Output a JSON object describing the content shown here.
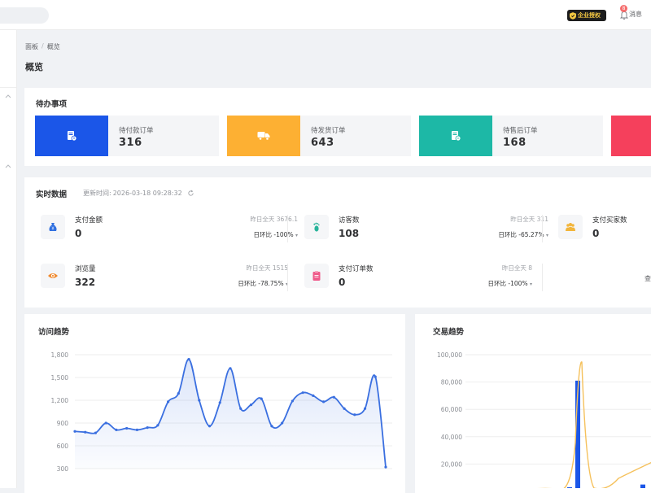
{
  "header": {
    "brand_badge": "企业授权",
    "messages_label": "消息",
    "messages_count": "8"
  },
  "breadcrumb": [
    "面板",
    "/",
    "概览"
  ],
  "page_title": "概览",
  "todo": {
    "title": "待办事项",
    "items": [
      {
        "label": "待付款订单",
        "value": "316",
        "color": "#1b56e8",
        "icon": "order-pay-icon"
      },
      {
        "label": "待发货订单",
        "value": "643",
        "color": "#fdb033",
        "icon": "truck-icon"
      },
      {
        "label": "待售后订单",
        "value": "168",
        "color": "#1db8a6",
        "icon": "after-sale-icon"
      },
      {
        "label": "",
        "value": "",
        "color": "#f5405c",
        "icon": "order-icon"
      }
    ]
  },
  "realtime": {
    "title": "实时数据",
    "update_label": "更新时间:",
    "update_time": "2026-03-18 09:28:32",
    "metrics": [
      {
        "label": "支付金额",
        "value": "0",
        "yesterday": "昨日全天 3676.1",
        "compare": "日环比 -100%",
        "icon": "money-bag-icon",
        "icon_color": "#2f6fe0"
      },
      {
        "label": "访客数",
        "value": "108",
        "yesterday": "昨日全天 311",
        "compare": "日环比 -65.27%",
        "icon": "footprint-icon",
        "icon_color": "#27b39a"
      },
      {
        "label": "支付买家数",
        "value": "0",
        "yesterday": "",
        "compare": "",
        "icon": "users-icon",
        "icon_color": "#f2b53a"
      },
      {
        "label": "浏览量",
        "value": "322",
        "yesterday": "昨日全天 1515",
        "compare": "日环比 -78.75%",
        "icon": "eye-icon",
        "icon_color": "#f08a2e"
      },
      {
        "label": "支付订单数",
        "value": "0",
        "yesterday": "昨日全天 8",
        "compare": "日环比 -100%",
        "icon": "clipboard-icon",
        "icon_color": "#ef5a8a"
      }
    ],
    "truncated_text": "查"
  },
  "visit_chart": {
    "title": "访问趋势",
    "y_ticks": [
      "1,800",
      "1,500",
      "1,200",
      "900",
      "600",
      "300"
    ]
  },
  "trade_chart": {
    "title": "交易趋势",
    "y_ticks": [
      "100,000",
      "80,000",
      "60,000",
      "40,000",
      "20,000"
    ]
  },
  "chart_data": [
    {
      "type": "line",
      "title": "访问趋势",
      "ylim": [
        300,
        1800
      ],
      "series": [
        {
          "values": [
            790,
            780,
            770,
            900,
            810,
            830,
            810,
            840,
            870,
            1180,
            1290,
            1740,
            1200,
            860,
            1170,
            1620,
            1090,
            1140,
            1220,
            860,
            900,
            1190,
            1300,
            1260,
            1180,
            1240,
            1090,
            1010,
            1090,
            1510,
            320
          ]
        }
      ],
      "grid": true
    },
    {
      "type": "bar",
      "title": "交易趋势",
      "ylim": [
        0,
        100000
      ],
      "series": [
        {
          "values": [
            81000,
            3000,
            2000,
            5000
          ]
        },
        {
          "values": [
            97000,
            5000,
            4000,
            10000
          ]
        }
      ],
      "grid": true
    }
  ]
}
